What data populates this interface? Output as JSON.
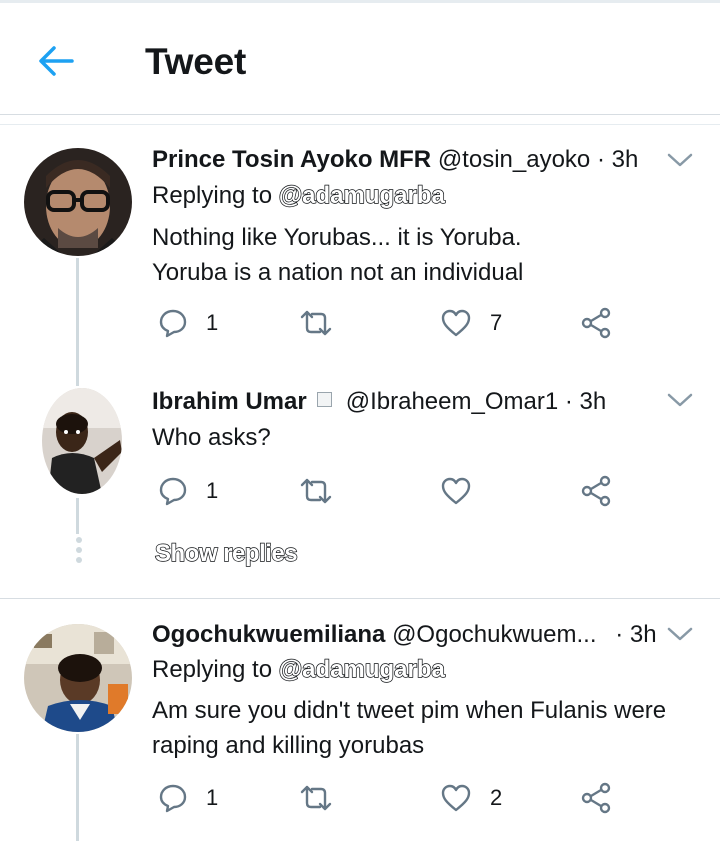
{
  "header": {
    "title": "Tweet"
  },
  "tweets": [
    {
      "name": "Prince Tosin Ayoko MFR",
      "handle": "@tosin_ayoko",
      "time": "· 3h",
      "replying_label": "Replying to",
      "replying_to": "@adamugarba",
      "text_lines": [
        "Nothing like Yorubas... it is Yoruba.",
        "Yoruba is a nation not an individual"
      ],
      "reply_count": "1",
      "retweet_count": "",
      "like_count": "7"
    },
    {
      "name": "Ibrahim Umar",
      "handle": "@Ibraheem_Omar1",
      "time": "· 3h",
      "text_lines": [
        "Who asks?"
      ],
      "reply_count": "1",
      "retweet_count": "",
      "like_count": ""
    },
    {
      "name": "Ogochukwuemiliana",
      "handle": "@Ogochukwuem...",
      "time": "· 3h",
      "replying_label": "Replying to",
      "replying_to": "@adamugarba",
      "text_lines": [
        "Am sure you didn't tweet pim when Fulanis were",
        "raping and killing yorubas"
      ],
      "reply_count": "1",
      "retweet_count": "",
      "like_count": "2"
    }
  ],
  "show_replies": "Show replies",
  "colors": {
    "accent": "#1da1f2",
    "text": "#14171a",
    "icon": "#657786",
    "divider": "#e6ecf0"
  }
}
